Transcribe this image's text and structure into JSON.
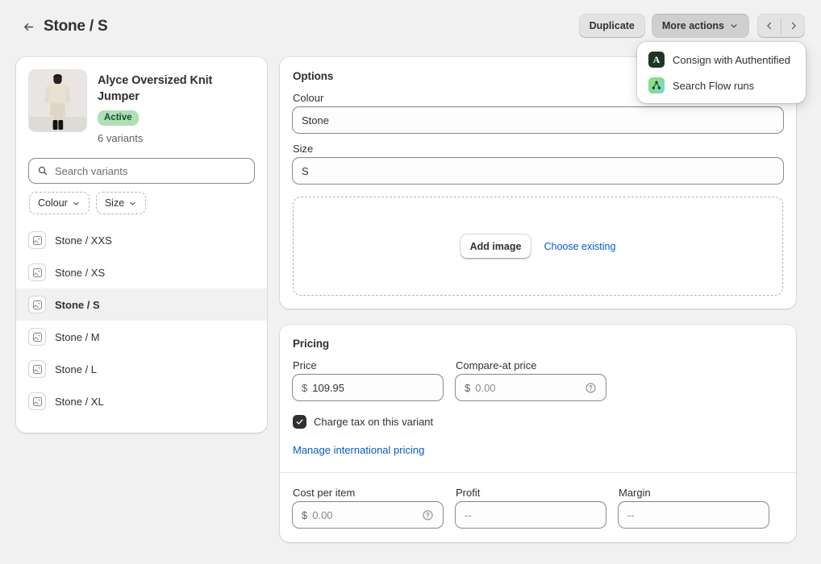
{
  "header": {
    "back_icon": "arrow-left-icon",
    "title": "Stone / S",
    "duplicate_label": "Duplicate",
    "more_actions_label": "More actions",
    "caret_icon": "chevron-down-icon",
    "prev_icon": "chevron-left-icon",
    "next_icon": "chevron-right-icon"
  },
  "dropdown": {
    "items": [
      {
        "label": "Consign with Authentified",
        "icon": "authentified-app-icon",
        "glyph": "A"
      },
      {
        "label": "Search Flow runs",
        "icon": "shopify-flow-app-icon",
        "glyph": ""
      }
    ]
  },
  "product": {
    "thumbnail_icon": "product-thumbnail",
    "title": "Alyce Oversized Knit Jumper",
    "status": "Active",
    "status_color": "#afe0b5",
    "variant_count": "6 variants"
  },
  "search": {
    "icon": "search-icon",
    "placeholder": "Search variants",
    "value": ""
  },
  "filters": [
    {
      "label": "Colour",
      "icon": "chevron-down-icon"
    },
    {
      "label": "Size",
      "icon": "chevron-down-icon"
    }
  ],
  "variants": [
    {
      "label": "Stone / XXS",
      "selected": false
    },
    {
      "label": "Stone / XS",
      "selected": false
    },
    {
      "label": "Stone / S",
      "selected": true
    },
    {
      "label": "Stone / M",
      "selected": false
    },
    {
      "label": "Stone / L",
      "selected": false
    },
    {
      "label": "Stone / XL",
      "selected": false
    }
  ],
  "options": {
    "title": "Options",
    "colour_label": "Colour",
    "colour_value": "Stone",
    "size_label": "Size",
    "size_value": "S",
    "add_image_label": "Add image",
    "choose_existing_label": "Choose existing"
  },
  "pricing": {
    "title": "Pricing",
    "price_label": "Price",
    "price_currency": "$",
    "price_value": "109.95",
    "compare_label": "Compare-at price",
    "compare_currency": "$",
    "compare_placeholder": "0.00",
    "compare_help_icon": "question-circle-icon",
    "charge_tax_label": "Charge tax on this variant",
    "charge_tax_checked": true,
    "international_link": "Manage international pricing",
    "cost_label": "Cost per item",
    "cost_currency": "$",
    "cost_placeholder": "0.00",
    "cost_help_icon": "question-circle-icon",
    "profit_label": "Profit",
    "profit_value": "--",
    "margin_label": "Margin",
    "margin_value": "--"
  },
  "colors": {
    "link": "#005bd3",
    "page_bg": "#f1f1f1",
    "text": "#303030"
  }
}
